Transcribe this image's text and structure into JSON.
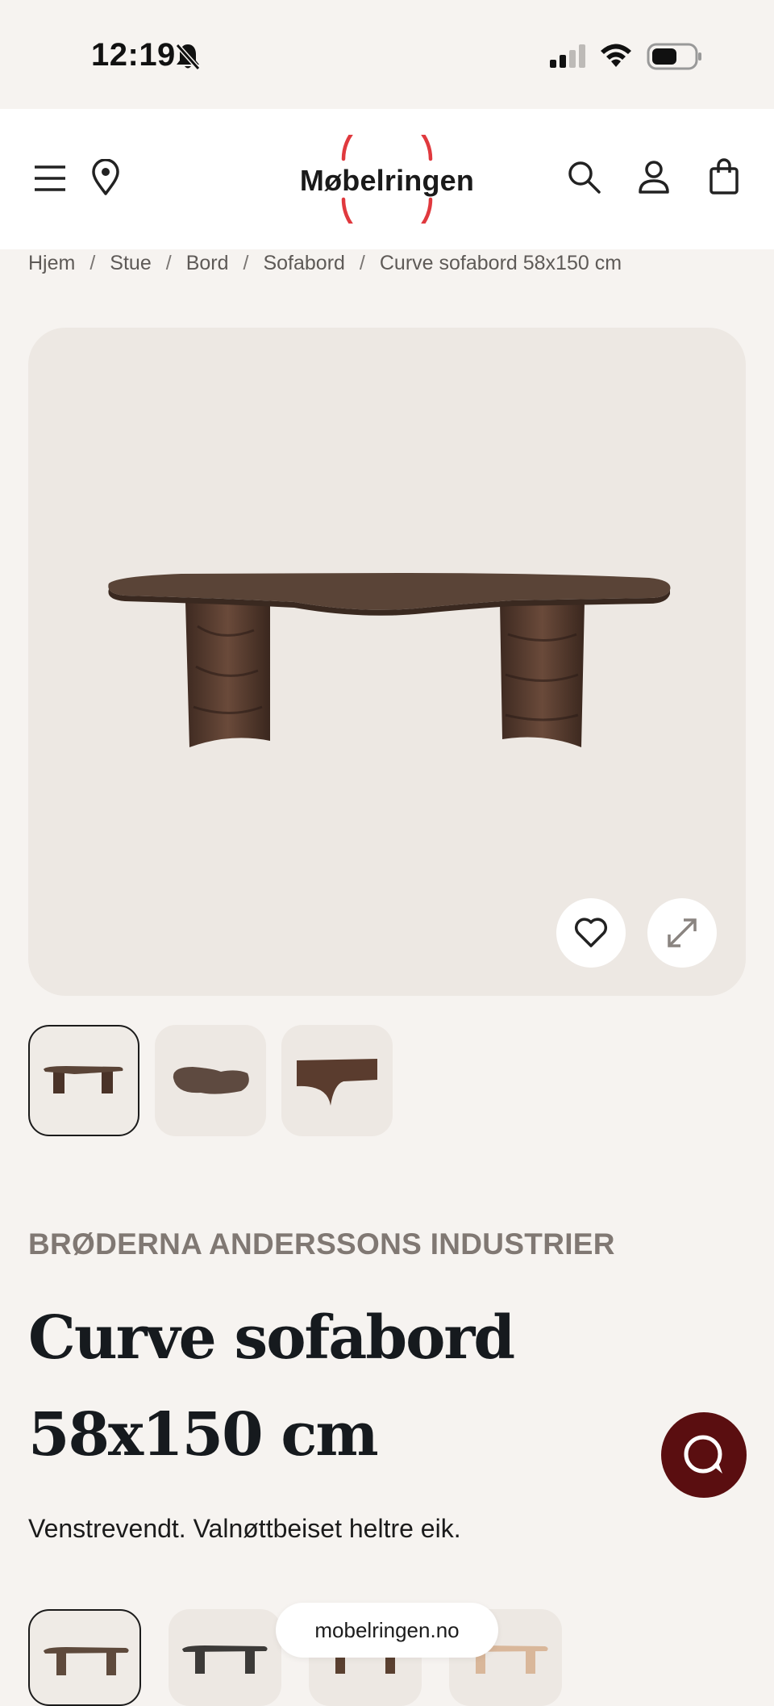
{
  "status_bar": {
    "time": "12:19",
    "icons": [
      "bell-slash-icon",
      "signal-icon",
      "wifi-icon",
      "battery-icon"
    ]
  },
  "header": {
    "logo_text": "Møbelringen",
    "brand_color": "#e0393e",
    "icons": [
      "menu-icon",
      "location-pin-icon",
      "search-icon",
      "account-icon",
      "shopping-bag-icon"
    ]
  },
  "breadcrumb": {
    "items": [
      "Hjem",
      "Stue",
      "Bord",
      "Sofabord",
      "Curve sofabord 58x150 cm"
    ],
    "separator": "/"
  },
  "gallery": {
    "main_image": "walnut-coffee-table-image",
    "buttons": [
      "heart-icon",
      "expand-icon"
    ],
    "thumbnails": [
      "thumbnail-side-view",
      "thumbnail-top-view",
      "thumbnail-detail-view"
    ],
    "active_thumbnail": 0
  },
  "product": {
    "brand": "BRØDERNA ANDERSSONS INDUSTRIER",
    "title": "Curve sofabord 58x150 cm",
    "description": "Venstrevendt. Valnøttbeiset heltre eik."
  },
  "variants": {
    "colors": [
      "#5e4a3c",
      "#3c3a38",
      "#5a4030",
      "#d9b79a"
    ],
    "active": 0
  },
  "chat": {
    "icon": "chat-icon",
    "color": "#5a0e10"
  },
  "browser": {
    "url": "mobelringen.no"
  }
}
